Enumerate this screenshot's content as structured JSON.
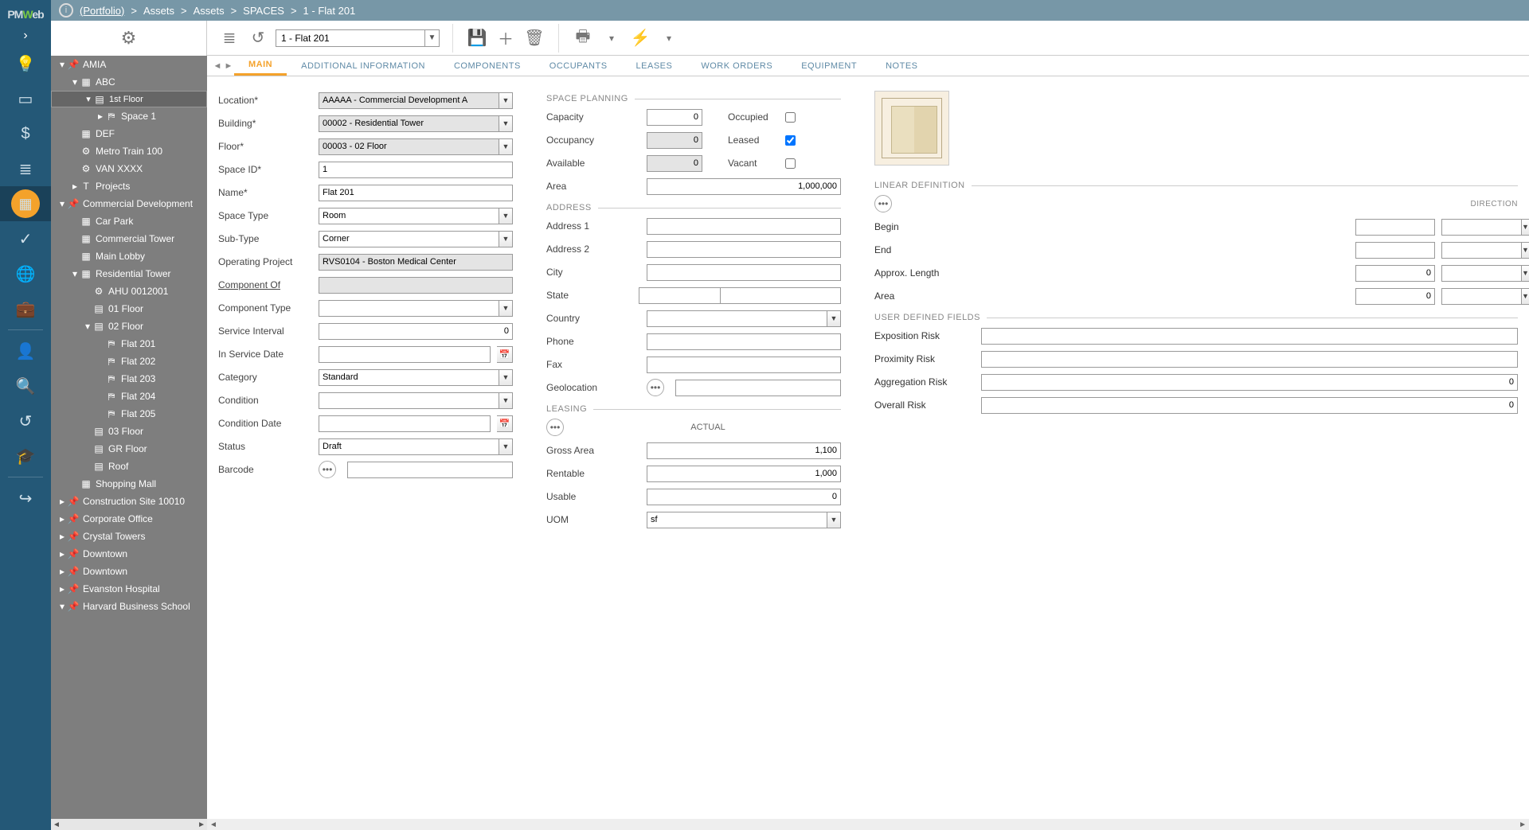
{
  "logo": {
    "pre": "PM",
    "mid": "W",
    "post": "eb"
  },
  "breadcrumb": {
    "root": "(Portfolio)",
    "sep": ">",
    "p1": "Assets",
    "p2": "Assets",
    "p3": "SPACES",
    "p4": "1 - Flat 201"
  },
  "toolbar": {
    "record": "1 - Flat 201"
  },
  "tabs": {
    "main": "MAIN",
    "addl": "ADDITIONAL INFORMATION",
    "comp": "COMPONENTS",
    "occ": "OCCUPANTS",
    "leases": "LEASES",
    "wo": "WORK ORDERS",
    "equip": "EQUIPMENT",
    "notes": "NOTES"
  },
  "tree": [
    {
      "d": 0,
      "a": "▾",
      "i": "📌",
      "t": "AMIA"
    },
    {
      "d": 1,
      "a": "▾",
      "i": "▦",
      "t": "ABC"
    },
    {
      "d": 2,
      "a": "▾",
      "i": "▤",
      "t": "1st Floor",
      "sel": true
    },
    {
      "d": 3,
      "a": "▸",
      "i": "⛿",
      "t": "Space 1"
    },
    {
      "d": 1,
      "a": "",
      "i": "▦",
      "t": "DEF"
    },
    {
      "d": 1,
      "a": "",
      "i": "⚙",
      "t": "Metro Train 100"
    },
    {
      "d": 1,
      "a": "",
      "i": "⚙",
      "t": "VAN XXXX"
    },
    {
      "d": 1,
      "a": "▸",
      "i": "T",
      "t": "Projects"
    },
    {
      "d": 0,
      "a": "▾",
      "i": "📌",
      "t": "Commercial Development"
    },
    {
      "d": 1,
      "a": "",
      "i": "▦",
      "t": "Car Park"
    },
    {
      "d": 1,
      "a": "",
      "i": "▦",
      "t": "Commercial Tower"
    },
    {
      "d": 1,
      "a": "",
      "i": "▦",
      "t": "Main Lobby"
    },
    {
      "d": 1,
      "a": "▾",
      "i": "▦",
      "t": "Residential Tower"
    },
    {
      "d": 2,
      "a": "",
      "i": "⚙",
      "t": "AHU 0012001"
    },
    {
      "d": 2,
      "a": "",
      "i": "▤",
      "t": "01 Floor"
    },
    {
      "d": 2,
      "a": "▾",
      "i": "▤",
      "t": "02 Floor"
    },
    {
      "d": 3,
      "a": "",
      "i": "⛿",
      "t": "Flat 201"
    },
    {
      "d": 3,
      "a": "",
      "i": "⛿",
      "t": "Flat 202"
    },
    {
      "d": 3,
      "a": "",
      "i": "⛿",
      "t": "Flat 203"
    },
    {
      "d": 3,
      "a": "",
      "i": "⛿",
      "t": "Flat 204"
    },
    {
      "d": 3,
      "a": "",
      "i": "⛿",
      "t": "Flat 205"
    },
    {
      "d": 2,
      "a": "",
      "i": "▤",
      "t": "03 Floor"
    },
    {
      "d": 2,
      "a": "",
      "i": "▤",
      "t": "GR Floor"
    },
    {
      "d": 2,
      "a": "",
      "i": "▤",
      "t": "Roof"
    },
    {
      "d": 1,
      "a": "",
      "i": "▦",
      "t": "Shopping Mall"
    },
    {
      "d": 0,
      "a": "▸",
      "i": "📌",
      "t": "Construction Site 10010"
    },
    {
      "d": 0,
      "a": "▸",
      "i": "📌",
      "t": "Corporate Office"
    },
    {
      "d": 0,
      "a": "▸",
      "i": "📌",
      "t": "Crystal Towers"
    },
    {
      "d": 0,
      "a": "▸",
      "i": "📌",
      "t": "Downtown"
    },
    {
      "d": 0,
      "a": "▸",
      "i": "📌",
      "t": "Downtown"
    },
    {
      "d": 0,
      "a": "▸",
      "i": "📌",
      "t": "Evanston Hospital"
    },
    {
      "d": 0,
      "a": "▾",
      "i": "📌",
      "t": "Harvard Business School"
    }
  ],
  "labels": {
    "location": "Location*",
    "building": "Building*",
    "floor": "Floor*",
    "spaceid": "Space ID*",
    "name": "Name*",
    "spacetype": "Space Type",
    "subtype": "Sub-Type",
    "opproj": "Operating Project",
    "compof": "Component Of",
    "comptype": "Component Type",
    "svcint": "Service Interval",
    "insvc": "In Service Date",
    "category": "Category",
    "condition": "Condition",
    "conddate": "Condition Date",
    "status": "Status",
    "barcode": "Barcode",
    "spaceplan": "SPACE PLANNING",
    "capacity": "Capacity",
    "occupancy": "Occupancy",
    "available": "Available",
    "area": "Area",
    "occupied": "Occupied",
    "leased": "Leased",
    "vacant": "Vacant",
    "address": "ADDRESS",
    "addr1": "Address 1",
    "addr2": "Address 2",
    "city": "City",
    "state": "State",
    "country": "Country",
    "phone": "Phone",
    "fax": "Fax",
    "geo": "Geolocation",
    "leasing": "LEASING",
    "actual": "ACTUAL",
    "gross": "Gross Area",
    "rentable": "Rentable",
    "usable": "Usable",
    "uom": "UOM",
    "linear": "LINEAR DEFINITION",
    "direction": "DIRECTION",
    "begin": "Begin",
    "end": "End",
    "approx": "Approx. Length",
    "larea": "Area",
    "udf": "USER DEFINED FIELDS",
    "exprisk": "Exposition Risk",
    "proxrisk": "Proximity Risk",
    "aggrisk": "Aggregation Risk",
    "ovrisk": "Overall Risk"
  },
  "values": {
    "location": "AAAAA - Commercial Development A",
    "building": "00002 - Residential Tower",
    "floor": "00003 - 02 Floor",
    "spaceid": "1",
    "name": "Flat 201",
    "spacetype": "Room",
    "subtype": "Corner",
    "opproj": "RVS0104 - Boston Medical Center",
    "svcint": "0",
    "category": "Standard",
    "status": "Draft",
    "capacity": "0",
    "occupancy": "0",
    "available": "0",
    "area": "1,000,000",
    "gross": "1,100",
    "rentable": "1,000",
    "usable": "0",
    "uom": "sf",
    "approx": "0",
    "larea": "0",
    "aggrisk": "0",
    "ovrisk": "0",
    "occupied": false,
    "leased": true,
    "vacant": false
  }
}
